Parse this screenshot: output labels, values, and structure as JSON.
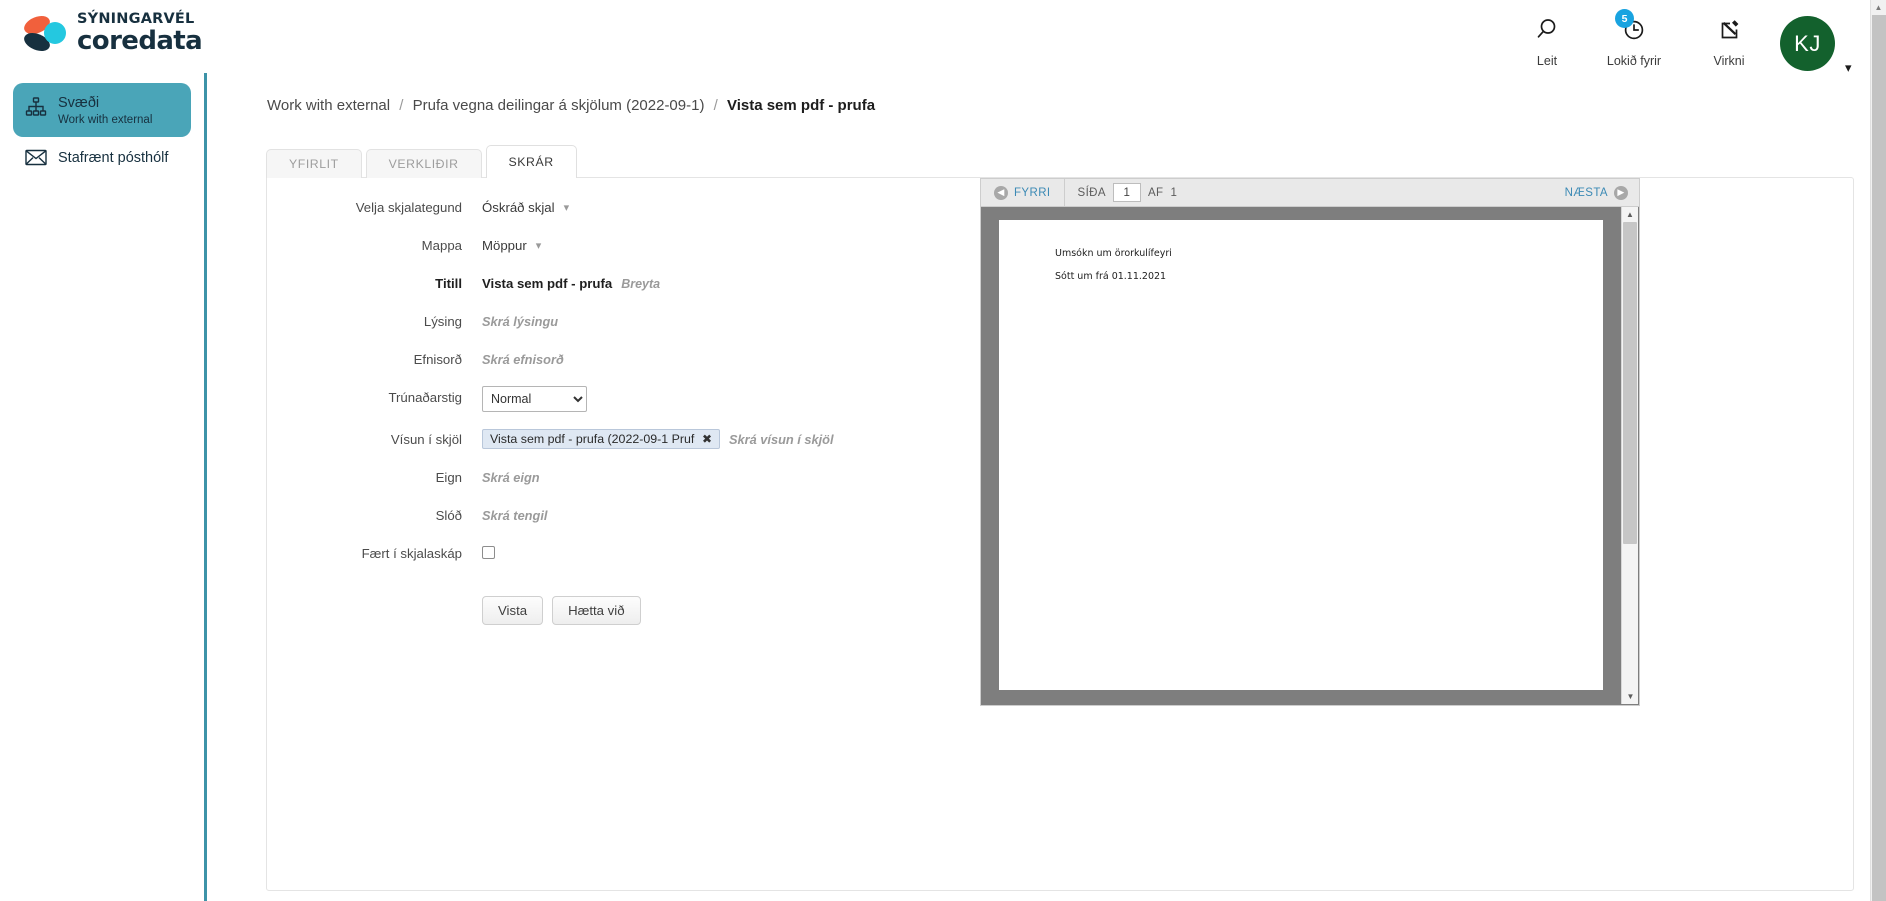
{
  "brand": {
    "name_small": "SÝNINGARVÉL",
    "name_big": "coredata",
    "colors": {
      "orange": "#f1603c",
      "navy": "#17303f",
      "cyan": "#24c8e0",
      "teal": "#4aa5b8"
    }
  },
  "sidebar": {
    "items": [
      {
        "icon": "sitemap-icon",
        "title": "Svæði",
        "subtitle": "Work with external",
        "active": true
      },
      {
        "icon": "envelope-icon",
        "title": "Stafrænt pósthólf",
        "subtitle": "",
        "active": false
      }
    ]
  },
  "topbar": {
    "actions": [
      {
        "icon": "search-icon",
        "label": "Leit",
        "badge": ""
      },
      {
        "icon": "clock-icon",
        "label": "Lokið fyrir",
        "badge": "5"
      },
      {
        "icon": "edit-square-icon",
        "label": "Virkni",
        "badge": ""
      }
    ],
    "avatar": {
      "initials": "KJ",
      "color": "#13612d"
    },
    "badge_color": "#19a3e0"
  },
  "breadcrumb": {
    "items": [
      "Work with external",
      "Prufa vegna deilingar á skjölum (2022-09-1)"
    ],
    "current": "Vista sem pdf - prufa",
    "separator": "/"
  },
  "tabs": [
    {
      "label": "YFIRLIT",
      "active": false
    },
    {
      "label": "VERKLIÐIR",
      "active": false
    },
    {
      "label": "SKRÁR",
      "active": true
    }
  ],
  "form": {
    "rows": [
      {
        "label": "Velja skjalategund",
        "type": "dropdown-text",
        "value": "Óskráð skjal"
      },
      {
        "label": "Mappa",
        "type": "dropdown-text",
        "value": "Möppur"
      },
      {
        "label": "Titill",
        "type": "value-edit",
        "value": "Vista sem pdf - prufa",
        "action": "Breyta",
        "bold": true
      },
      {
        "label": "Lýsing",
        "type": "placeholder",
        "placeholder": "Skrá lýsingu"
      },
      {
        "label": "Efnisorð",
        "type": "placeholder",
        "placeholder": "Skrá efnisorð"
      },
      {
        "label": "Trúnaðarstig",
        "type": "select",
        "value": "Normal",
        "options": [
          "Normal"
        ]
      },
      {
        "label": "Vísun í skjöl",
        "type": "chip",
        "chip": "Vista sem pdf - prufa (2022-09-1 Prufa v...)",
        "placeholder": "Skrá vísun í skjöl"
      },
      {
        "label": "Eign",
        "type": "placeholder",
        "placeholder": "Skrá eign"
      },
      {
        "label": "Slóð",
        "type": "placeholder",
        "placeholder": "Skrá tengil"
      },
      {
        "label": "Fært í skjalaskáp",
        "type": "checkbox",
        "checked": false
      }
    ],
    "buttons": [
      {
        "label": "Vista",
        "name": "save-button"
      },
      {
        "label": "Hætta við",
        "name": "cancel-button"
      }
    ]
  },
  "pdf_viewer": {
    "prev_label": "FYRRI",
    "next_label": "NÆSTA",
    "page_word": "SÍÐA",
    "of_word": "AF",
    "current_page": "1",
    "total_pages": "1",
    "document_lines": [
      "Umsókn um örorkulífeyri",
      "Sótt um frá 01.11.2021"
    ]
  }
}
